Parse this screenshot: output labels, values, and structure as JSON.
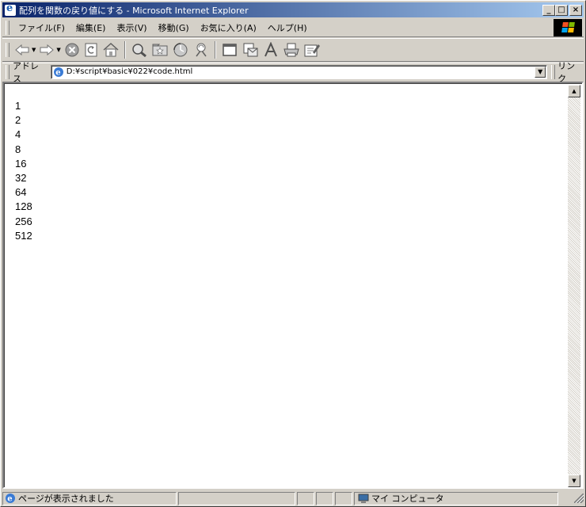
{
  "window": {
    "title": "配列を関数の戻り値にする - Microsoft Internet Explorer",
    "minimize_glyph": "_",
    "maximize_glyph": "□",
    "close_glyph": "×"
  },
  "menu": {
    "items": [
      {
        "label": "ファイル(F)"
      },
      {
        "label": "編集(E)"
      },
      {
        "label": "表示(V)"
      },
      {
        "label": "移動(G)"
      },
      {
        "label": "お気に入り(A)"
      },
      {
        "label": "ヘルプ(H)"
      }
    ]
  },
  "toolbar": {
    "buttons": [
      "back-icon",
      "forward-icon",
      "stop-icon",
      "refresh-icon",
      "home-icon",
      "search-icon",
      "favorites-icon",
      "history-icon",
      "channels-icon",
      "fullscreen-icon",
      "mail-icon",
      "font-icon",
      "print-icon",
      "edit-icon"
    ]
  },
  "address": {
    "label": "アドレス",
    "url": "D:¥script¥basic¥022¥code.html",
    "links_label": "リンク"
  },
  "content": {
    "lines": [
      "1",
      "2",
      "4",
      "8",
      "16",
      "32",
      "64",
      "128",
      "256",
      "512"
    ]
  },
  "status": {
    "text": "ページが表示されました",
    "zone": "マイ コンピュータ"
  },
  "colors": {
    "title_start": "#0a246a",
    "title_end": "#a6caf0",
    "chrome": "#d4d0c8"
  }
}
